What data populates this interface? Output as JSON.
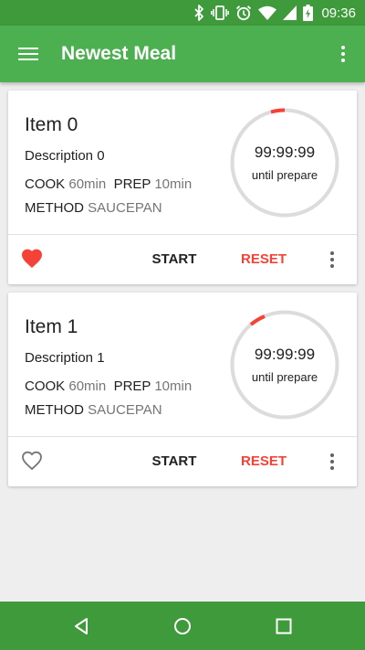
{
  "status_bar": {
    "time": "09:36",
    "icons": [
      "bluetooth-icon",
      "vibrate-icon",
      "alarm-icon",
      "wifi-icon",
      "signal-icon",
      "battery-icon"
    ]
  },
  "app_bar": {
    "title": "Newest Meal",
    "menu_icon": "menu-icon",
    "overflow_icon": "overflow-menu-icon"
  },
  "colors": {
    "primary": "#4caf50",
    "primary_dark": "#3e9a3a",
    "accent": "#f44336",
    "background": "#eeeeee"
  },
  "recipes": [
    {
      "title": "Item 0",
      "description": "Description 0",
      "cook_label": "COOK",
      "cook_value": "60min",
      "prep_label": "PREP",
      "prep_value": "10min",
      "method_label": "METHOD",
      "method_value": "SAUCEPAN",
      "timer_time": "99:99:99",
      "timer_label": "until prepare",
      "favorite": true,
      "start_label": "START",
      "reset_label": "RESET"
    },
    {
      "title": "Item 1",
      "description": "Description 1",
      "cook_label": "COOK",
      "cook_value": "60min",
      "prep_label": "PREP",
      "prep_value": "10min",
      "method_label": "METHOD",
      "method_value": "SAUCEPAN",
      "timer_time": "99:99:99",
      "timer_label": "until prepare",
      "favorite": false,
      "start_label": "START",
      "reset_label": "RESET"
    }
  ],
  "nav_bar": {
    "buttons": [
      "back-icon",
      "home-icon",
      "recents-icon"
    ]
  }
}
